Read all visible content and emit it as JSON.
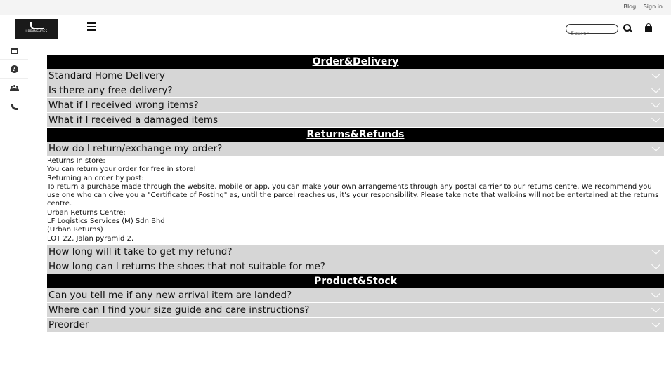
{
  "top_links": {
    "blog": "Blog",
    "sign_in": "Sign in"
  },
  "logo": {
    "text": "URBANSHOES"
  },
  "search": {
    "placeholder": "Search"
  },
  "icons": {
    "hamburger": "menu-icon",
    "search": "search-icon",
    "bag": "shopping-bag-icon"
  },
  "sidebar": {
    "items": [
      {
        "icon": "store-icon"
      },
      {
        "icon": "help-icon",
        "glyph": "?"
      },
      {
        "icon": "users-icon"
      },
      {
        "icon": "phone-icon"
      }
    ]
  },
  "sections": [
    {
      "title": "Order&Delivery",
      "questions": [
        "Standard Home Delivery",
        "Is there any free delivery?",
        "What if I received wrong items?",
        "What if I received a damaged items"
      ]
    },
    {
      "title": "Returns&Refunds",
      "questions": [
        "How do I return/exchange my order?",
        "How long will it take to get my refund?",
        "How long can I returns the shoes that not suitable for me?"
      ],
      "answer_lines": [
        "Returns In store:",
        "You can return your order for free in store!",
        "Returning an order by post:",
        "To return a purchase made through the website, mobile or app, you can make your own arrangements through any postal carrier to our returns centre. We recommend you use one who can give you a \"Certificate of Posting\" as, until the parcel reaches us, it's your responsibility. Please take note that walk-ins will not be entertained at the returns centre.",
        "Urban Returns Centre:",
        "LF Logistics Services (M) Sdn Bhd",
        "(Urban Returns)",
        "LOT 22, Jalan pyramid 2,"
      ]
    },
    {
      "title": "Product&Stock",
      "questions": [
        "Can you tell me if any new arrival item are landed?",
        "Where can I find your size guide and care instructions?",
        "Preorder"
      ]
    }
  ],
  "colors": {
    "section_bg": "#000000",
    "question_bg": "#d6d6d6",
    "topbar_bg": "#f4f4f4"
  }
}
